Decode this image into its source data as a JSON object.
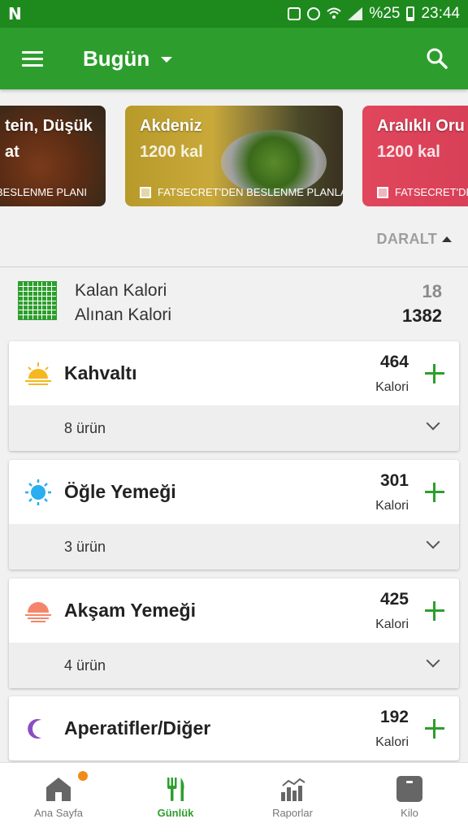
{
  "status_bar": {
    "left_icon": "N",
    "battery_percent": "%25",
    "time": "23:44",
    "icons": [
      "recycle-icon",
      "alarm-icon",
      "wifi-icon",
      "signal-icon",
      "battery-icon"
    ]
  },
  "app_bar": {
    "title": "Bugün",
    "icons": [
      "menu-icon",
      "dropdown-caret-icon",
      "search-icon"
    ]
  },
  "promos": [
    {
      "name": "tein, Düşük",
      "kcal": "at",
      "tag": "N BESLENME PLANI"
    },
    {
      "name": "Akdeniz",
      "kcal": "1200 kal",
      "tag": "FATSECRET'DEN BESLENME PLANLA"
    },
    {
      "name": "Aralıklı Oru",
      "kcal": "1200 kal",
      "tag": "FATSECRET'DE"
    }
  ],
  "collapse_label": "DARALT",
  "summary": {
    "remaining_label": "Kalan Kalori",
    "remaining_value": "18",
    "consumed_label": "Alınan Kalori",
    "consumed_value": "1382"
  },
  "meals": [
    {
      "name": "Kahvaltı",
      "calories": "464",
      "unit": "Kalori",
      "items": "8 ürün",
      "icon": "sunrise-icon"
    },
    {
      "name": "Öğle Yemeği",
      "calories": "301",
      "unit": "Kalori",
      "items": "3 ürün",
      "icon": "sun-icon"
    },
    {
      "name": "Akşam Yemeği",
      "calories": "425",
      "unit": "Kalori",
      "items": "4 ürün",
      "icon": "sunset-icon"
    },
    {
      "name": "Aperatifler/Diğer",
      "calories": "192",
      "unit": "Kalori",
      "icon": "moon-icon"
    }
  ],
  "nav": [
    {
      "label": "Ana Sayfa",
      "icon": "home-icon"
    },
    {
      "label": "Günlük",
      "icon": "fork-knife-icon"
    },
    {
      "label": "Raporlar",
      "icon": "chart-icon"
    },
    {
      "label": "Kilo",
      "icon": "scale-icon"
    }
  ],
  "colors": {
    "status_bar": "#1e8a1e",
    "app_bar": "#2d9e2d",
    "accent": "#2d9e2d",
    "badge": "#f08a1c"
  }
}
